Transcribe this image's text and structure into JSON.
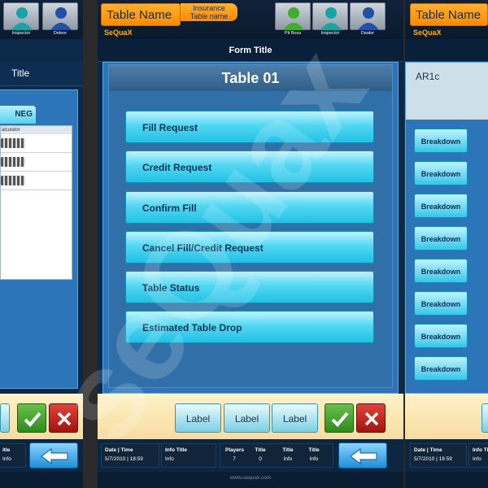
{
  "header": {
    "table_name": "Table Name",
    "insurance": "Insurance",
    "table_name_sub": "Table name",
    "brand": "SeQuaX",
    "roles": [
      "Pit Boss",
      "Inspector",
      "Dealer"
    ]
  },
  "left_screen": {
    "title": "Title",
    "tab": "NEG",
    "calculator_label": "alculator",
    "roles": [
      "Inspector",
      "Deleer"
    ]
  },
  "center_screen": {
    "form_title": "Form Title",
    "table_title": "Table 01",
    "menu": [
      "Fill Request",
      "Credit Request",
      "Confirm Fill",
      "Cancel Fill/Credit Request",
      "Table Status",
      "Estimated Table Drop"
    ],
    "labels": [
      "Label",
      "Label",
      "Label"
    ]
  },
  "right_screen": {
    "ar_label": "AR1c",
    "breakdown": [
      "Breakdown",
      "Breakdown",
      "Breakdown",
      "Breakdown",
      "Breakdown",
      "Breakdown",
      "Breakdown",
      "Breakdown"
    ]
  },
  "info": {
    "date_time_header": "Date  |  Time",
    "date_time_value": "5/7/2010  |  18:59",
    "info_title_header": "Info Title",
    "info_value": "Info",
    "players_header": "Players",
    "players_value": "7",
    "title_header": "Title",
    "title_value": "0",
    "title2_header": "Title",
    "title2_value": "Info",
    "title3_header": "Title",
    "title3_value": "Info",
    "left_title_header": "itle",
    "left_info_value": "Info",
    "right_info_header": "Info Ti",
    "right_info_value": "Info"
  },
  "footer": {
    "url": "www.sequax.com"
  },
  "watermark": "seQuax",
  "colors": {
    "accent_orange": "#ff8a00",
    "menu_cyan": "#52d8f2",
    "navy": "#0b2a4a"
  }
}
